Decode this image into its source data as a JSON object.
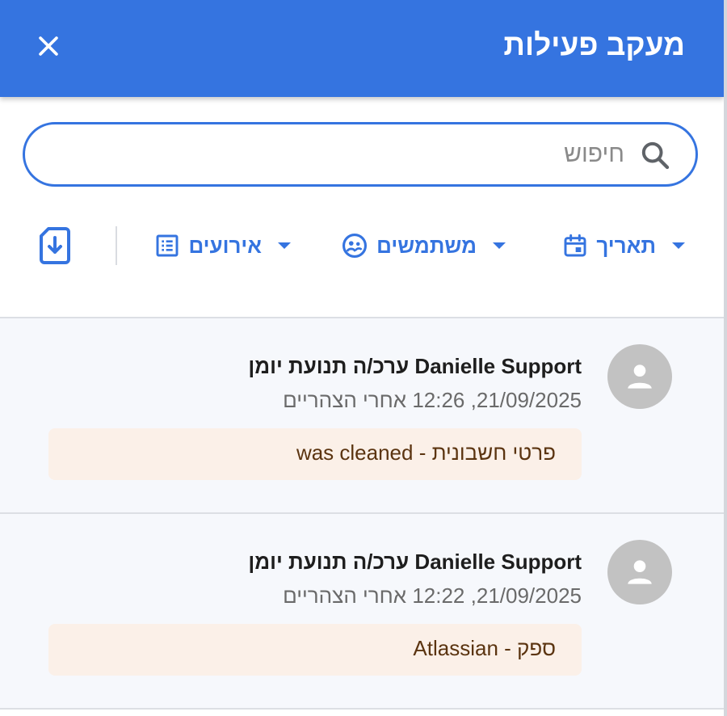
{
  "header": {
    "title": "מעקב פעילות",
    "close_icon": "close-icon"
  },
  "search": {
    "placeholder": "חיפוש",
    "value": "",
    "icon": "search-icon"
  },
  "filters": [
    {
      "label": "תאריך",
      "icon": "calendar-icon"
    },
    {
      "label": "משתמשים",
      "icon": "users-icon"
    },
    {
      "label": "אירועים",
      "icon": "list-icon"
    }
  ],
  "export": {
    "icon": "file-download-icon"
  },
  "activities": [
    {
      "title": "Danielle Support ערכ/ה תנועת יומן",
      "time": "21/09/2025, 12:26 אחרי הצהריים",
      "change": "פרטי חשבונית - was cleaned"
    },
    {
      "title": "Danielle Support ערכ/ה תנועת יומן",
      "time": "21/09/2025, 12:22 אחרי הצהריים",
      "change": "ספק - Atlassian"
    }
  ],
  "colors": {
    "accent": "#3574e0",
    "change_bg": "#fbf0e8",
    "item_bg": "#f6f8fc"
  }
}
